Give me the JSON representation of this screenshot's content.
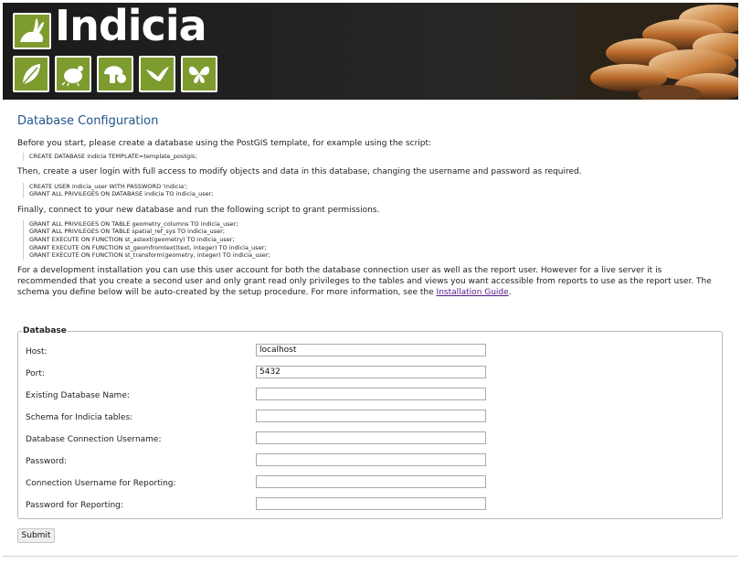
{
  "brand": {
    "name": "Indicia"
  },
  "page": {
    "title": "Database Configuration",
    "intro1": "Before you start, please create a database using the PostGIS template, for example using the script:",
    "code1": [
      "CREATE DATABASE indicia TEMPLATE=template_postgis;"
    ],
    "intro2": "Then, create a user login with full access to modify objects and data in this database, changing the username and password as required.",
    "code2": [
      "CREATE USER indicia_user WITH PASSWORD 'indicia';",
      "GRANT ALL PRIVILEGES ON DATABASE indicia TO indicia_user;"
    ],
    "intro3": "Finally, connect to your new database and run the following script to grant permissions.",
    "code3": [
      "GRANT ALL PRIVILEGES ON TABLE geometry_columns TO indicia_user;",
      "GRANT ALL PRIVILEGES ON TABLE spatial_ref_sys TO indicia_user;",
      "GRANT EXECUTE ON FUNCTION st_astext(geometry) TO indicia_user;",
      "GRANT EXECUTE ON FUNCTION st_geomfromtext(text, integer) TO indicia_user;",
      "GRANT EXECUTE ON FUNCTION st_transform(geometry, integer) TO indicia_user;"
    ],
    "note_text": "For a development installation you can use this user account for both the database connection user as well as the report user. However for a live server it is recommended that you create a second user and only grant read only privileges to the tables and views you want accessible from reports to use as the report user. The schema you define below will be auto-created by the setup procedure. For more information, see the",
    "note_link": "Installation Guide",
    "note_end": "."
  },
  "form": {
    "legend": "Database",
    "fields": [
      {
        "label": "Host:",
        "value": "localhost"
      },
      {
        "label": "Port:",
        "value": "5432"
      },
      {
        "label": "Existing Database Name:",
        "value": ""
      },
      {
        "label": "Schema for Indicia tables:",
        "value": ""
      },
      {
        "label": "Database Connection Username:",
        "value": ""
      },
      {
        "label": "Password:",
        "value": ""
      },
      {
        "label": "Connection Username for Reporting:",
        "value": ""
      },
      {
        "label": "Password for Reporting:",
        "value": ""
      }
    ],
    "submit_label": "Submit"
  },
  "colors": {
    "title": "#22558a",
    "brand_green": "#7e9b2e",
    "link": "#551a8b"
  },
  "icons": [
    "rabbit-icon",
    "leaf-icon",
    "beetle-icon",
    "mushroom-icon",
    "bird-icon",
    "butterfly-icon"
  ]
}
